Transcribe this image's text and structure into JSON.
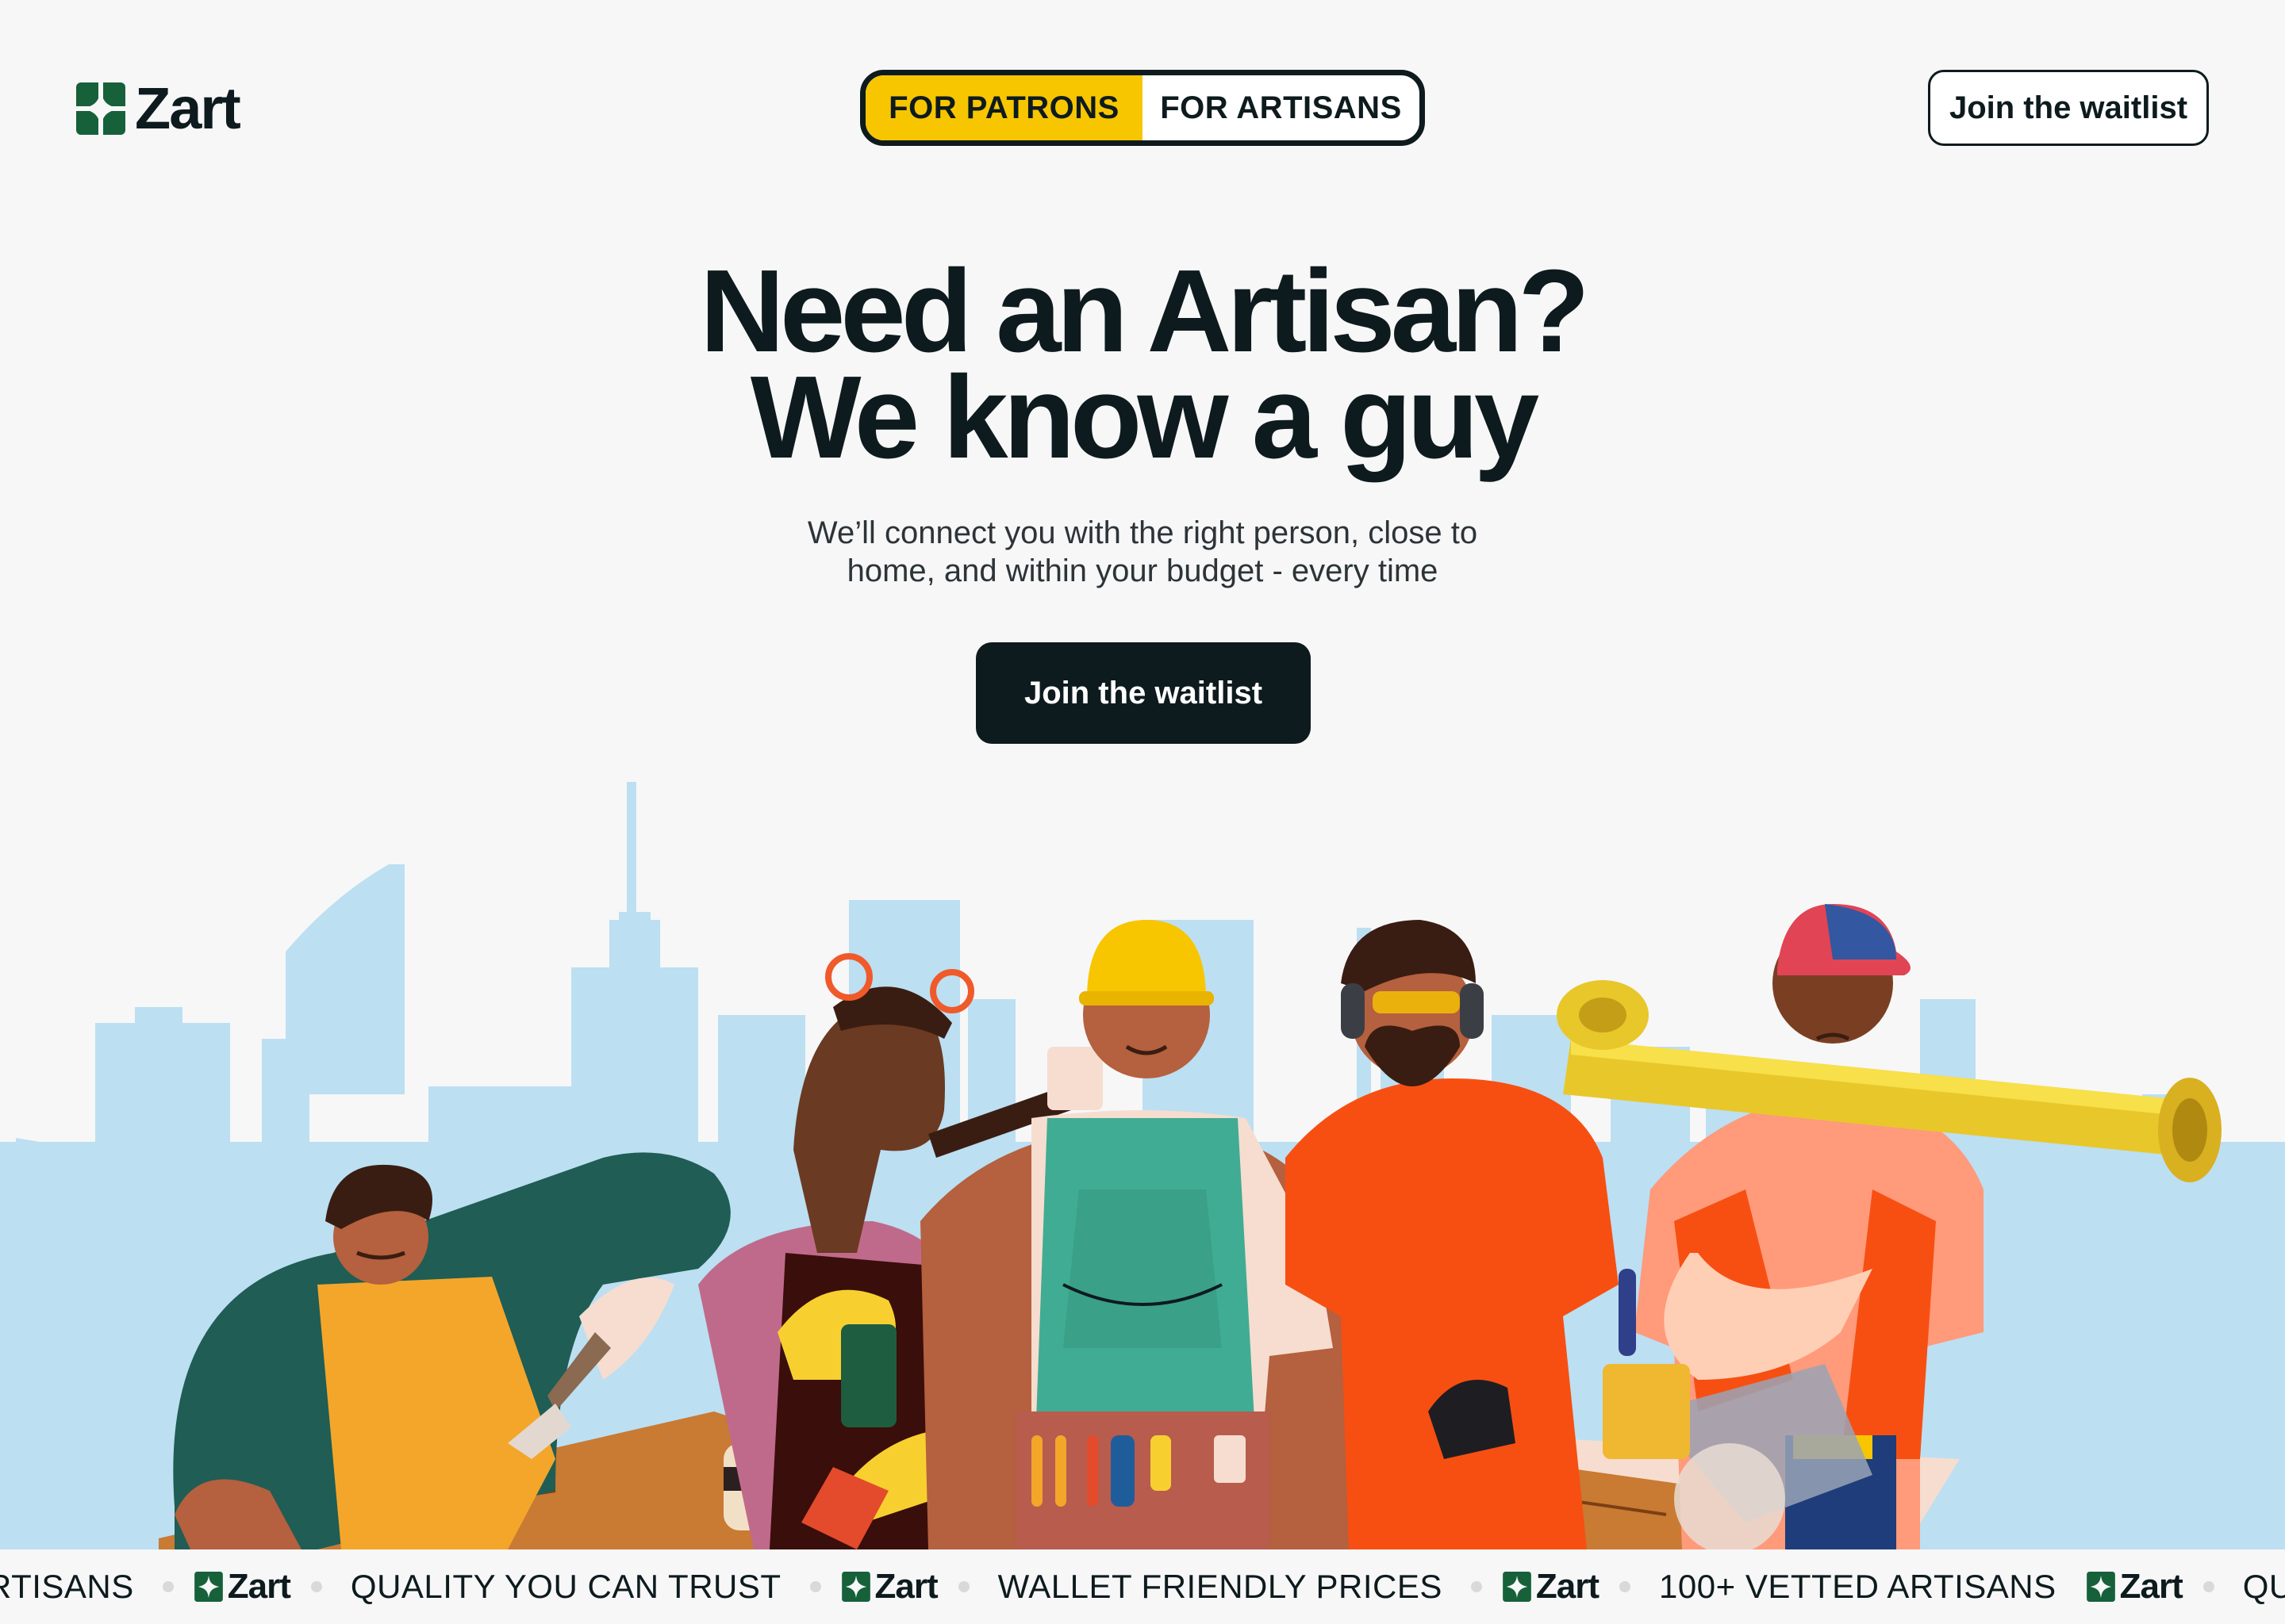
{
  "brand": {
    "name": "Zart",
    "logo_color": "#16613a",
    "accent": "#f7c600",
    "ink": "#0e1b1e"
  },
  "nav": {
    "toggle": [
      {
        "label": "FOR PATRONS",
        "active": true
      },
      {
        "label": "FOR ARTISANS",
        "active": false
      }
    ],
    "cta_label": "Join the waitlist"
  },
  "hero": {
    "title_line1": "Need an Artisan?",
    "title_line2": "We know a guy",
    "subtitle_line1": "We’ll connect you with the right person, close to",
    "subtitle_line2": "home, and within your budget - every time",
    "cta_label": "Join the waitlist"
  },
  "illustration": {
    "description_icons": [
      "skyline",
      "painter",
      "woodworker-with-hammer",
      "builder-with-tool-belt",
      "welder-with-earmuffs",
      "plumber-with-pipe"
    ]
  },
  "marquee": {
    "items": [
      "100+ VETTED ARTISANS",
      "QUALITY YOU CAN TRUST",
      "WALLET FRIENDLY PRICES",
      "100+ VETTED ARTISANS",
      "QUALITY YOU CAN TRUST"
    ],
    "first_fragment": "RTISANS"
  }
}
